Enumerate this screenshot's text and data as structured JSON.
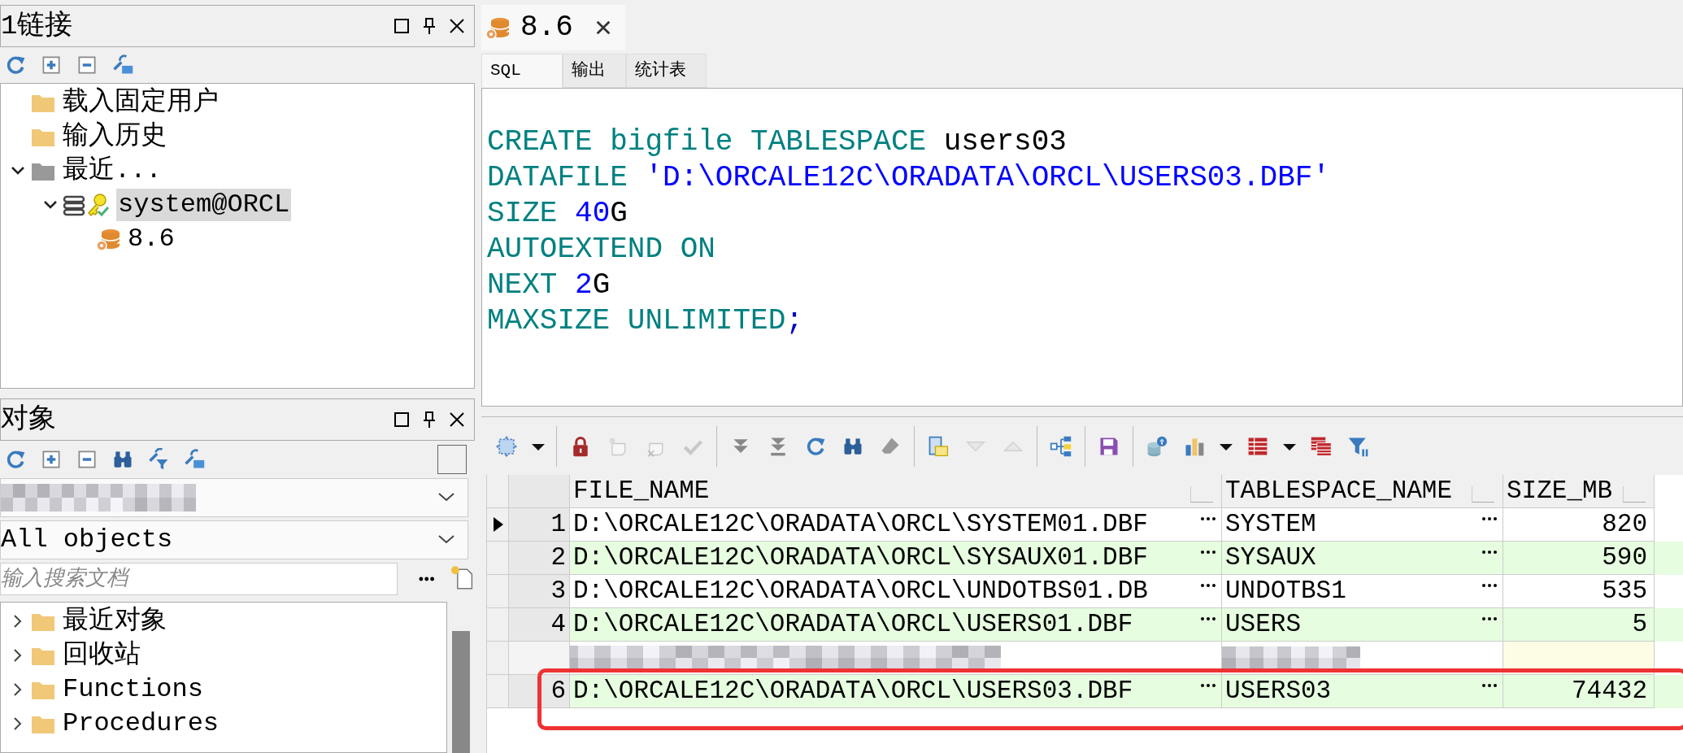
{
  "connections_panel": {
    "title": "1链接",
    "toolbar": [
      {
        "kind": "refresh"
      },
      {
        "kind": "expand"
      },
      {
        "kind": "collapse"
      },
      {
        "kind": "wrench_folder"
      }
    ],
    "tree": [
      {
        "label": "载入固定用户",
        "kind": "folder",
        "selected": false
      },
      {
        "label": "输入历史",
        "kind": "folder",
        "selected": false
      },
      {
        "label": "最近...",
        "kind": "folder_grey",
        "selected": false,
        "expanded": true,
        "children": [
          {
            "label": "system@ORCL",
            "kind": "connection",
            "selected": true,
            "expanded": true,
            "children": [
              {
                "label": "8.6",
                "kind": "sql_window",
                "selected": false
              }
            ]
          }
        ]
      }
    ]
  },
  "objects_panel": {
    "title": "对象",
    "toolbar": [
      {
        "kind": "refresh"
      },
      {
        "kind": "expand"
      },
      {
        "kind": "collapse"
      },
      {
        "kind": "find"
      },
      {
        "kind": "wrench_filter"
      },
      {
        "kind": "wrench_folder"
      }
    ],
    "owner_select": {
      "redacted": true
    },
    "type_select": {
      "value": "All objects"
    },
    "search": {
      "placeholder": "输入搜索文档"
    },
    "tree": [
      {
        "label": "最近对象",
        "kind": "folder",
        "selected": false,
        "expanded": false
      },
      {
        "label": "回收站",
        "kind": "folder",
        "selected": false,
        "expanded": false
      },
      {
        "label": "Functions",
        "kind": "folder",
        "selected": false,
        "expanded": false
      },
      {
        "label": "Procedures",
        "kind": "folder",
        "selected": false,
        "expanded": false
      }
    ]
  },
  "editor": {
    "tab": {
      "label": "8.6"
    },
    "subtabs": [
      {
        "label": "SQL",
        "selected": true
      },
      {
        "label": "输出",
        "selected": false
      },
      {
        "label": "统计表",
        "selected": false
      }
    ],
    "code": [
      [
        {
          "kind": "keyword",
          "text": "CREATE bigfile TABLESPACE"
        },
        {
          "kind": "plain",
          "text": " users03"
        }
      ],
      [
        {
          "kind": "keyword",
          "text": "DATAFILE "
        },
        {
          "kind": "string",
          "text": "'D:\\ORCALE12C\\ORADATA\\ORCL\\USERS03.DBF'"
        }
      ],
      [
        {
          "kind": "keyword",
          "text": "SIZE "
        },
        {
          "kind": "number",
          "text": "40"
        },
        {
          "kind": "plain",
          "text": "G"
        }
      ],
      [
        {
          "kind": "keyword",
          "text": "AUTOEXTEND ON"
        }
      ],
      [
        {
          "kind": "keyword",
          "text": "NEXT "
        },
        {
          "kind": "number",
          "text": "2"
        },
        {
          "kind": "plain",
          "text": "G"
        }
      ],
      [
        {
          "kind": "keyword",
          "text": "MAXSIZE UNLIMITED"
        },
        {
          "kind": "symbol",
          "text": ";"
        }
      ]
    ]
  },
  "results": {
    "toolbar": [
      {
        "kind": "select",
        "disabled": false,
        "dropdown": true
      },
      {
        "kind": "separator"
      },
      {
        "kind": "lock",
        "disabled": false,
        "dropdown": false
      },
      {
        "kind": "new_record",
        "disabled": true,
        "dropdown": false
      },
      {
        "kind": "delete_record",
        "disabled": true,
        "dropdown": false
      },
      {
        "kind": "post",
        "disabled": true,
        "dropdown": false
      },
      {
        "kind": "separator"
      },
      {
        "kind": "fetch_next",
        "disabled": false,
        "dropdown": false
      },
      {
        "kind": "fetch_all",
        "disabled": false,
        "dropdown": false
      },
      {
        "kind": "refresh",
        "disabled": false,
        "dropdown": false
      },
      {
        "kind": "find",
        "disabled": false,
        "dropdown": false
      },
      {
        "kind": "clear",
        "disabled": false,
        "dropdown": false
      },
      {
        "kind": "separator"
      },
      {
        "kind": "form",
        "disabled": false,
        "dropdown": false
      },
      {
        "kind": "next",
        "disabled": true,
        "dropdown": false
      },
      {
        "kind": "prev",
        "disabled": true,
        "dropdown": false
      },
      {
        "kind": "separator"
      },
      {
        "kind": "tree",
        "disabled": false,
        "dropdown": false
      },
      {
        "kind": "separator"
      },
      {
        "kind": "save",
        "disabled": false,
        "dropdown": false
      },
      {
        "kind": "separator"
      },
      {
        "kind": "export",
        "disabled": false,
        "dropdown": false
      },
      {
        "kind": "chart",
        "disabled": false,
        "dropdown": true
      },
      {
        "kind": "table",
        "disabled": false,
        "dropdown": true
      },
      {
        "kind": "copy",
        "disabled": false,
        "dropdown": false
      },
      {
        "kind": "filter",
        "disabled": false,
        "dropdown": false
      }
    ],
    "columns": [
      "FILE_NAME",
      "TABLESPACE_NAME",
      "SIZE_MB"
    ],
    "rows": [
      {
        "number": "1",
        "current": true,
        "highlighted": false,
        "cells": [
          "D:\\ORCALE12C\\ORADATA\\ORCL\\SYSTEM01.DBF",
          "SYSTEM",
          "820"
        ]
      },
      {
        "number": "2",
        "current": false,
        "highlighted": false,
        "cells": [
          "D:\\ORCALE12C\\ORADATA\\ORCL\\SYSAUX01.DBF",
          "SYSAUX",
          "590"
        ]
      },
      {
        "number": "3",
        "current": false,
        "highlighted": false,
        "cells": [
          "D:\\ORCALE12C\\ORADATA\\ORCL\\UNDOTBS01.DB",
          "UNDOTBS1",
          "535"
        ]
      },
      {
        "number": "4",
        "current": false,
        "highlighted": false,
        "cells": [
          "D:\\ORCALE12C\\ORADATA\\ORCL\\USERS01.DBF",
          "USERS",
          "5"
        ]
      },
      {
        "redacted": true,
        "current": false,
        "highlighted": false
      },
      {
        "number": "6",
        "current": false,
        "highlighted": true,
        "cells": [
          "D:\\ORCALE12C\\ORADATA\\ORCL\\USERS03.DBF",
          "USERS03",
          "74432"
        ]
      }
    ]
  }
}
